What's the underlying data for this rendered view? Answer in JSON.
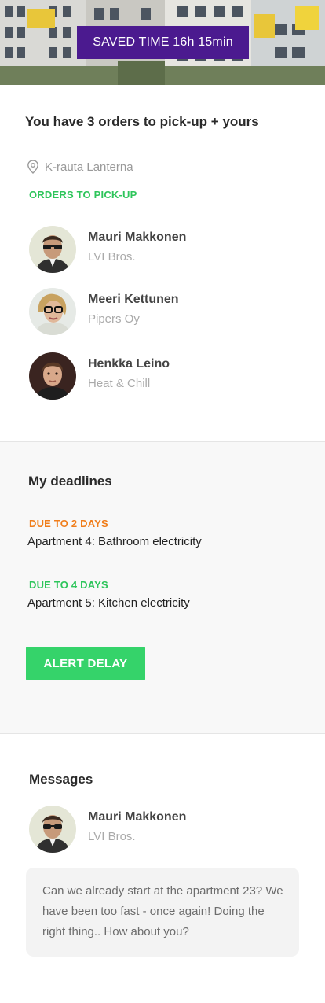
{
  "header": {
    "saved_time": "SAVED TIME 16h 15min"
  },
  "summary": {
    "title": "You have 3 orders to pick-up + yours",
    "location": "K-rauta Lanterna",
    "location_icon": "map-pin-icon",
    "orders_label": "ORDERS TO PICK-UP",
    "orders": [
      {
        "name": "Mauri Makkonen",
        "company": "LVI Bros."
      },
      {
        "name": "Meeri Kettunen",
        "company": "Pipers Oy"
      },
      {
        "name": "Henkka Leino",
        "company": "Heat & Chill"
      }
    ]
  },
  "deadlines": {
    "title": "My deadlines",
    "items": [
      {
        "due": "DUE TO 2 DAYS",
        "task": "Apartment 4: Bathroom electricity",
        "color": "#f07d1a"
      },
      {
        "due": "DUE TO 4 DAYS",
        "task": "Apartment 5: Kitchen electricity",
        "color": "#2ec55b"
      }
    ],
    "alert_button": "ALERT DELAY"
  },
  "messages": {
    "title": "Messages",
    "sender": {
      "name": "Mauri Makkonen",
      "company": "LVI Bros."
    },
    "text": "Can we already start at the apartment 23? We have been too fast - once again! Doing the right thing.. How about you?"
  },
  "colors": {
    "accent_purple": "#4b1a8f",
    "accent_green": "#35d36a",
    "label_green": "#2ec55b",
    "label_orange": "#f07d1a"
  }
}
